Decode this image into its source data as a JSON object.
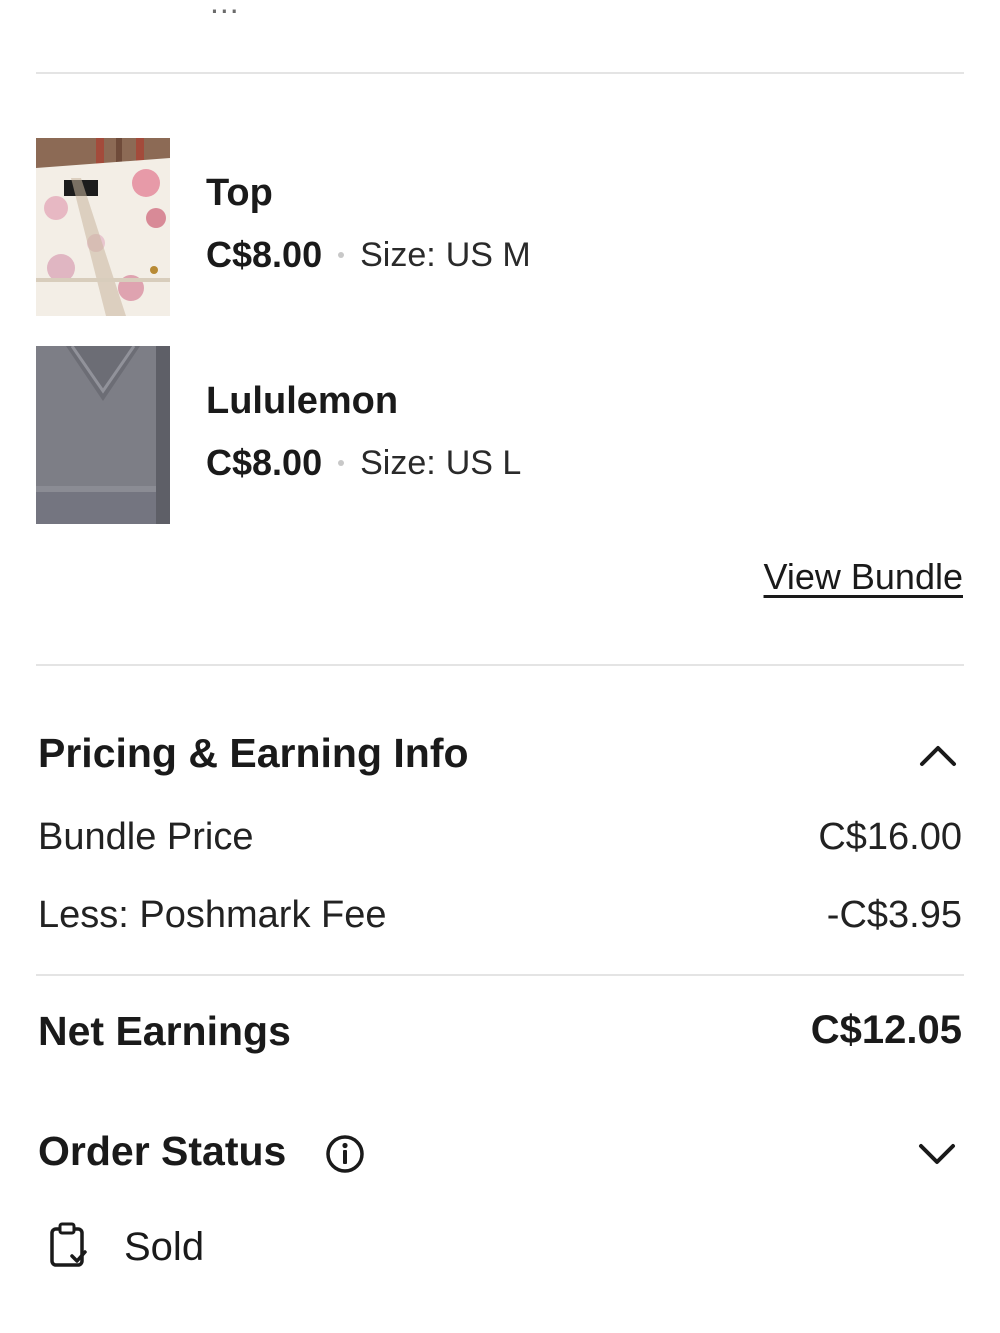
{
  "top_cut_text": "...",
  "items": [
    {
      "title": "Top",
      "price": "C$8.00",
      "size_label": "Size:",
      "size_value": "US M"
    },
    {
      "title": "Lululemon",
      "price": "C$8.00",
      "size_label": "Size:",
      "size_value": "US L"
    }
  ],
  "view_bundle_label": "View Bundle",
  "pricing": {
    "title": "Pricing & Earning Info",
    "bundle_price_label": "Bundle Price",
    "bundle_price_value": "C$16.00",
    "fee_label": "Less: Poshmark Fee",
    "fee_value": "-C$3.95",
    "net_label": "Net Earnings",
    "net_value": "C$12.05",
    "expanded_icon": "chevron-up-icon"
  },
  "order_status": {
    "title": "Order Status",
    "info_icon": "info-icon",
    "collapsed_icon": "chevron-down-icon",
    "status_icon": "clipboard-check-icon",
    "status_text": "Sold"
  },
  "colors": {
    "text": "#1a1a1a",
    "divider": "#e4e4e4",
    "background": "#ffffff"
  }
}
